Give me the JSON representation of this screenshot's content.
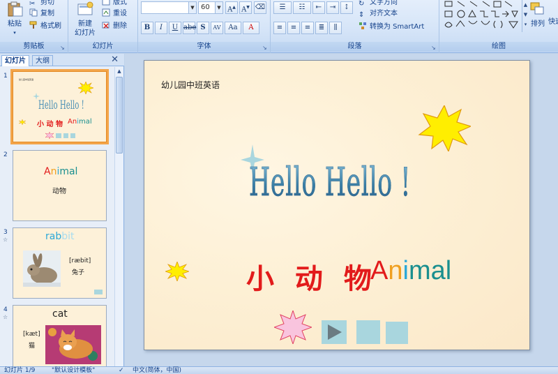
{
  "ribbon": {
    "clipboard": {
      "paste": "粘贴",
      "cut": "剪切",
      "copy": "复制",
      "format_painter": "格式刷",
      "label": "剪贴板"
    },
    "slides": {
      "new_slide_line1": "新建",
      "new_slide_line2": "幻灯片",
      "layout": "版式",
      "reset": "重设",
      "delete": "删除",
      "label": "幻灯片"
    },
    "font": {
      "font_size": "60",
      "label": "字体"
    },
    "paragraph": {
      "text_direction": "文字方向",
      "align_text": "对齐文本",
      "smartart": "转换为 SmartArt",
      "label": "段落"
    },
    "drawing": {
      "arrange": "排列",
      "quick_styles": "快速",
      "label": "绘图"
    }
  },
  "left_pane": {
    "tab_slides": "幻灯片",
    "tab_outline": "大纲",
    "close": "✕",
    "slide1": {
      "num": "1",
      "small_title": "幼儿园中班英语",
      "hello": "Hello Hello !",
      "cn": "小 动 物",
      "en_an": "An",
      "en_i": "i",
      "en_mal": "mal"
    },
    "slide2": {
      "num": "2",
      "en_a": "A",
      "en_n": "n",
      "en_i": "i",
      "en_mal": "mal",
      "cn": "动物"
    },
    "slide3": {
      "num": "3",
      "star": "☆",
      "word_rab": "rab",
      "word_bit": "bit",
      "phonetic": "[ræbit]",
      "cn": "兔子"
    },
    "slide4": {
      "num": "4",
      "star": "☆",
      "word": "cat",
      "phonetic": "[kæt]",
      "cn": "猫"
    }
  },
  "slide": {
    "small_title": "幼儿园中班英语",
    "hello": "Hello Hello !",
    "cn_title": "小 动 物",
    "en_A": "A",
    "en_n": "n",
    "en_i": "i",
    "en_mal": "mal",
    "colors": {
      "A": "#e21b1b",
      "n": "#f0a020",
      "i": "#2aa8d8",
      "mal": "#1a8f8f"
    }
  },
  "statusbar": {
    "slide_count": "幻灯片 1/9",
    "theme": "\"默认设计模板\"",
    "language": "中文(简体，中国)"
  }
}
